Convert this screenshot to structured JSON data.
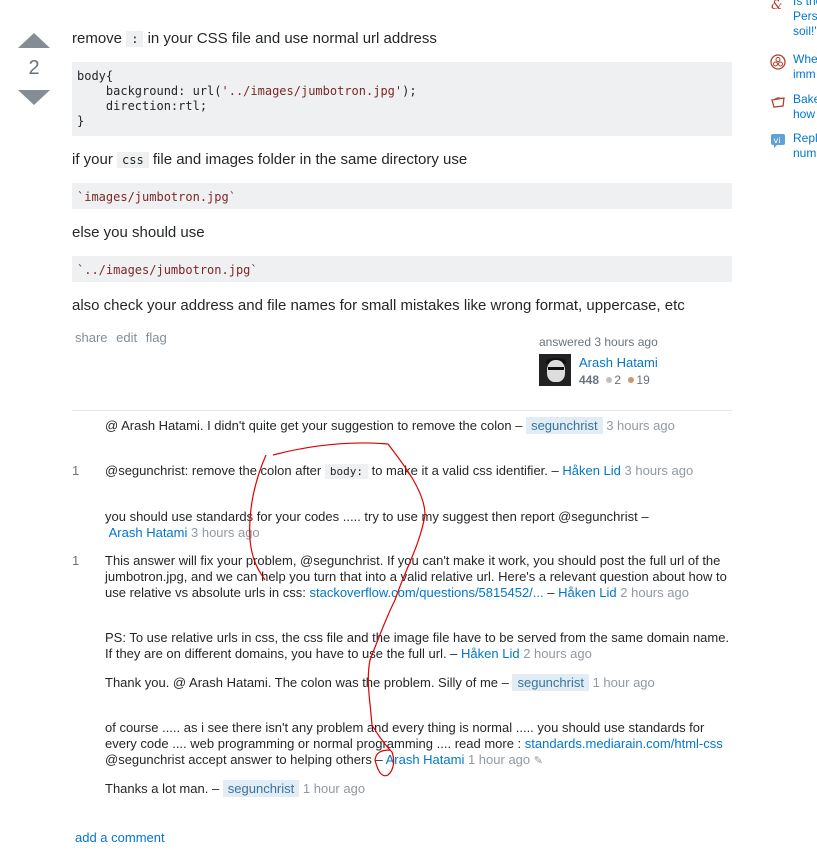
{
  "vote": {
    "count": "2",
    "upvote_label": "up vote",
    "downvote_label": "down vote"
  },
  "post": {
    "p1": {
      "before": "remove ",
      "code": ":",
      "after": " in your CSS file and use normal url address"
    },
    "code_block_1": {
      "line1": "body{",
      "line2_prefix": "    background: url(",
      "line2_string": "'../images/jumbotron.jpg'",
      "line2_suffix": ");",
      "line3": "    direction:rtl;",
      "line4": "}"
    },
    "p2": {
      "before": "if your ",
      "code": "css",
      "after": " file and images folder in the same directory use"
    },
    "code_block_2": "`images/jumbotron.jpg`",
    "p3": "else you should use",
    "code_block_3": "`../images/jumbotron.jpg`",
    "p4": "also check your address and file names for small mistakes like wrong format, uppercase, etc"
  },
  "post_menu": {
    "share": "share",
    "edit": "edit",
    "flag": "flag"
  },
  "user_card": {
    "action": "answered 3 hours ago",
    "name": "Arash Hatami",
    "reputation": "448",
    "silver_badges": "2",
    "bronze_badges": "19",
    "silver_color": "#c0c0c0",
    "bronze_color": "#cd9a6d"
  },
  "comments": [
    {
      "score": "",
      "text": "@ Arash Hatami. I didn't quite get your suggestion to remove the colon – ",
      "user": "segunchrist",
      "is_op": true,
      "time": "3 hours ago"
    },
    {
      "score": "1",
      "text_before": "@segunchrist: remove the colon after ",
      "code": "body:",
      "text_after": " to make it a valid css identifier. – ",
      "user": "Håken Lid",
      "is_op": false,
      "time": "3 hours ago"
    },
    {
      "score": "",
      "text": "you should use standards for your codes ..... try to use my suggest then report @segunchrist – ",
      "user": "Arash Hatami",
      "is_op": false,
      "time": "3 hours ago"
    },
    {
      "score": "1",
      "text": "This answer will fix your problem, @segunchrist. If you can't make it work, you should post the full url of the jumbotron.jpg, and we can help you turn that into a valid relative url. Here's a relevant question about how to use relative vs absolute urls in css: ",
      "link": "stackoverflow.com/questions/5815452/...",
      "sep": " – ",
      "user": "Håken Lid",
      "is_op": false,
      "time": "2 hours ago"
    },
    {
      "score": "",
      "text": "PS: To use relative urls in css, the css file and the image file have to be served from the same domain name. If they are on different domains, you have to use the full url. – ",
      "user": "Håken Lid",
      "is_op": false,
      "time": "2 hours ago"
    },
    {
      "score": "",
      "text": "Thank you. @ Arash Hatami. The colon was the problem. Silly of me – ",
      "user": "segunchrist",
      "is_op": true,
      "time": "1 hour ago"
    },
    {
      "score": "",
      "text": "of course ..... as i see there isn't any problem and every thing is normal ..... you should use standards for every code .... web programming or normal programming .... read more : ",
      "link": "standards.mediarain.com/html-css",
      "text_after": " @segunchrist accept answer to helping others – ",
      "user": "Arash Hatami",
      "is_op": false,
      "time": "1 hour ago",
      "edited_icon": "pencil-icon"
    },
    {
      "score": "",
      "text": "Thanks a lot man. – ",
      "user": "segunchrist",
      "is_op": true,
      "time": "1 hour ago"
    }
  ],
  "add_comment": "add a comment",
  "hot_questions": [
    {
      "icon": "english-icon",
      "title": "Is the\nPers\nsoil!'"
    },
    {
      "icon": "rpg-icon",
      "title": "Whe\nimm"
    },
    {
      "icon": "cooking-icon",
      "title": "Bake\nhow"
    },
    {
      "icon": "vi-icon",
      "title": "Repl\nnum"
    }
  ],
  "colors": {
    "link": "#0077cc",
    "text": "#242729",
    "muted": "#9199a1",
    "code_bg": "#eff0f1",
    "op_bg": "#e1ecf4",
    "annotation": "#e00000"
  }
}
